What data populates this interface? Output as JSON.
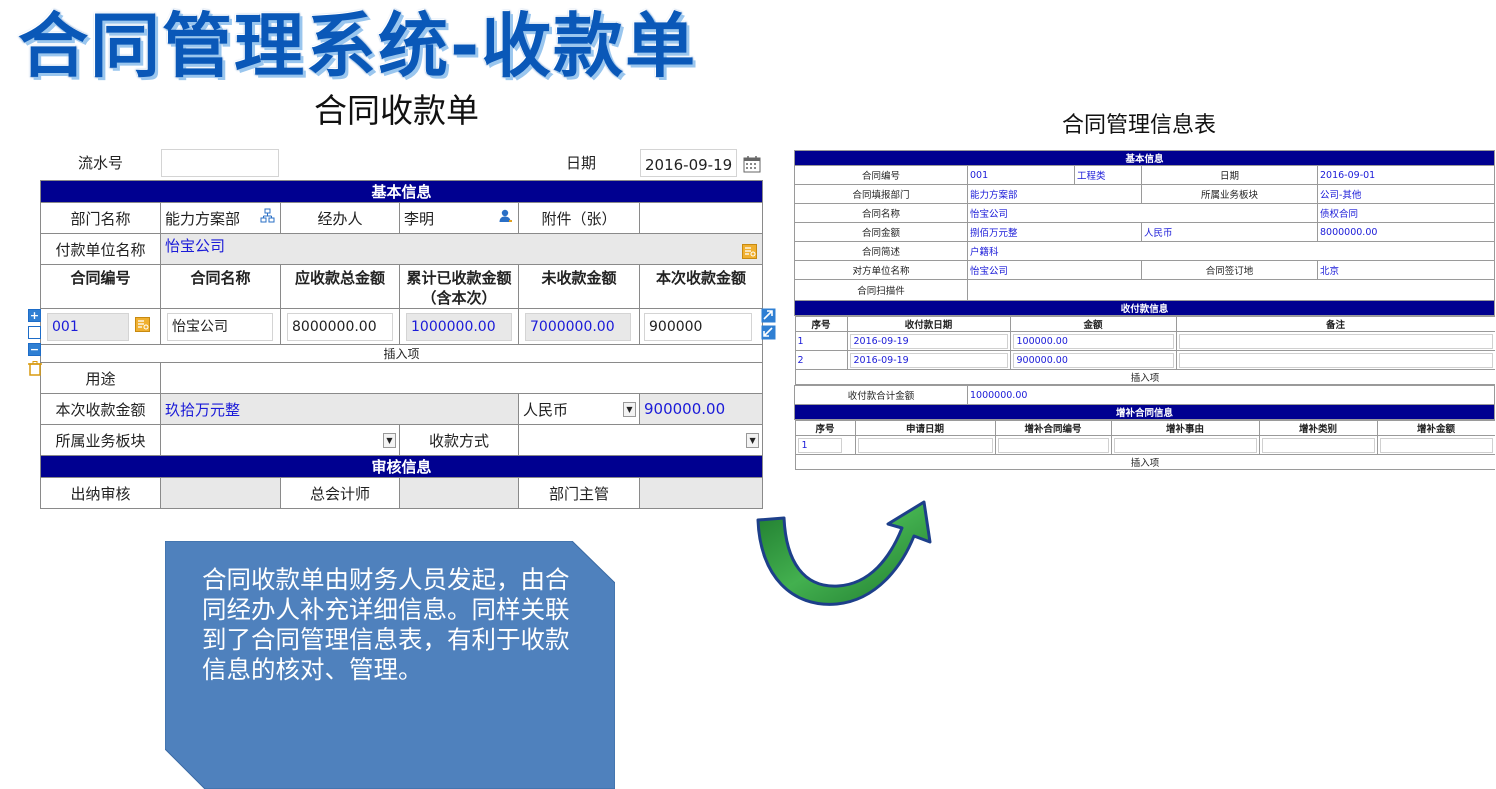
{
  "slide": {
    "title": "合同管理系统-收款单",
    "callout": "合同收款单由财务人员发起，由合同经办人补充详细信息。同样关联到了合同管理信息表，有利于收款信息的核对、管理。"
  },
  "receipt_form": {
    "caption": "合同收款单",
    "serial_label": "流水号",
    "serial_value": "",
    "date_label": "日期",
    "date_value": "2016-09-19",
    "basic_band": "基本信息",
    "dept_label": "部门名称",
    "dept_value": "能力方案部",
    "handler_label": "经办人",
    "handler_value": "李明",
    "attachment_label": "附件（张）",
    "attachment_value": "",
    "payer_label": "付款单位名称",
    "payer_value": "怡宝公司",
    "columns": [
      "合同编号",
      "合同名称",
      "应收款总金额",
      "累计已收款金额（含本次）",
      "未收款金额",
      "本次收款金额"
    ],
    "row": {
      "contract_no": "001",
      "contract_name": "怡宝公司",
      "total": "8000000.00",
      "received": "1000000.00",
      "unreceived": "7000000.00",
      "this_amount": "900000"
    },
    "insert_label": "插入项",
    "purpose_label": "用途",
    "purpose_value": "",
    "amount_label": "本次收款金额",
    "amount_upper": "玖拾万元整",
    "currency": "人民币",
    "amount_value": "900000.00",
    "segment_label": "所属业务板块",
    "segment_value": "",
    "method_label": "收款方式",
    "method_value": "",
    "audit_band": "审核信息",
    "cashier_label": "出纳审核",
    "chief_label": "总会计师",
    "manager_label": "部门主管"
  },
  "info_table": {
    "caption": "合同管理信息表",
    "basic_band": "基本信息",
    "contract_no_label": "合同编号",
    "contract_no": "001",
    "contract_type": "工程类",
    "date_label": "日期",
    "date": "2016-09-01",
    "dept_label": "合同填报部门",
    "dept": "能力方案部",
    "segment_label": "所属业务板块",
    "segment": "公司-其他",
    "name_label": "合同名称",
    "name": "怡宝公司",
    "category": "债权合同",
    "amount_label": "合同金额",
    "amount_upper": "捌佰万元整",
    "currency": "人民币",
    "amount": "8000000.00",
    "brief_label": "合同简述",
    "brief": "户籍科",
    "party_label": "对方单位名称",
    "party": "怡宝公司",
    "place_label": "合同签订地",
    "place": "北京",
    "scan_label": "合同扫描件",
    "payment_band": "收付款信息",
    "payment_cols": [
      "序号",
      "收付款日期",
      "金额",
      "备注"
    ],
    "payments": [
      {
        "no": "1",
        "date": "2016-09-19",
        "amount": "100000.00",
        "note": ""
      },
      {
        "no": "2",
        "date": "2016-09-19",
        "amount": "900000.00",
        "note": ""
      }
    ],
    "insert_label": "插入项",
    "total_label": "收付款合计金额",
    "total": "1000000.00",
    "supplement_band": "增补合同信息",
    "supplement_cols": [
      "序号",
      "申请日期",
      "增补合同编号",
      "增补事由",
      "增补类别",
      "增补金额"
    ],
    "supplement_row_no": "1",
    "insert_label2": "插入项"
  },
  "colors": {
    "band": "#000090",
    "callout_fill": "#4f81bd",
    "arrow_green": "#2f9a3c",
    "link_blue": "#1b1bd8"
  }
}
